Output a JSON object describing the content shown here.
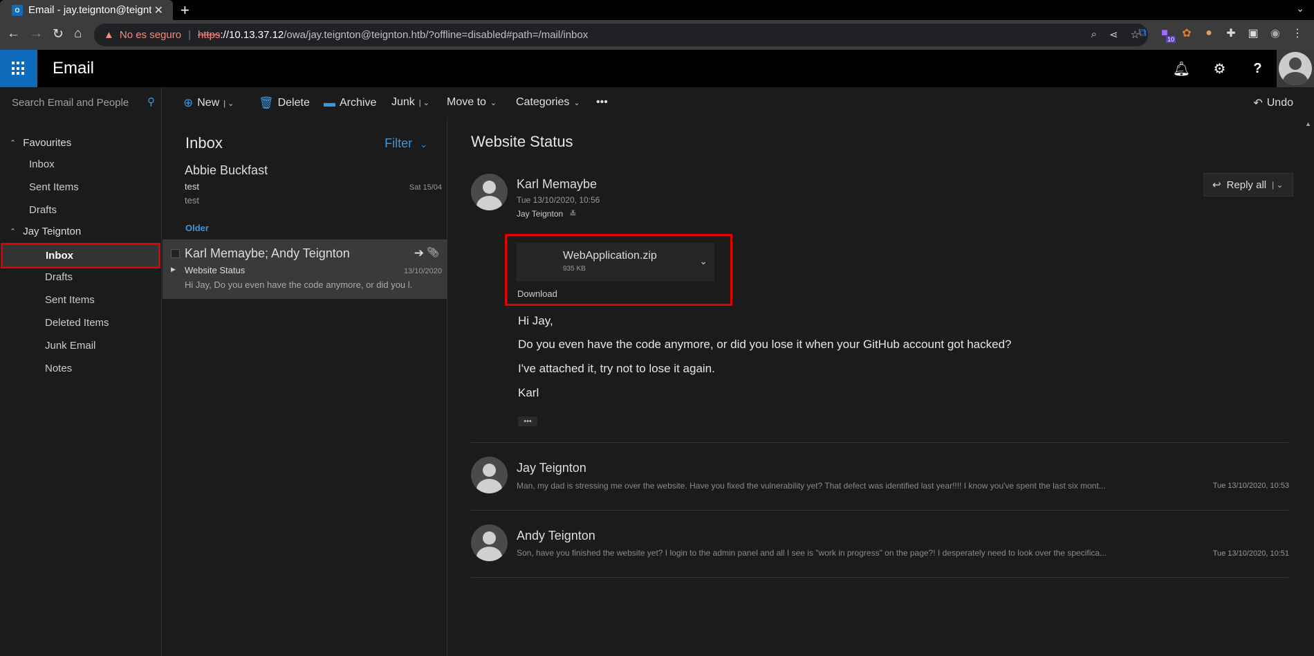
{
  "browser": {
    "tab_title": "Email - jay.teignton@teignton",
    "favicon_label": "O",
    "new_tab": "+",
    "security_label": "No es seguro",
    "url_scheme": "https",
    "url_host": "://10.13.37.12",
    "url_path": "/owa/jay.teignton@teignton.htb/?offline=disabled#path=/mail/inbox",
    "extension_badge": "10"
  },
  "app": {
    "title": "Email"
  },
  "search": {
    "placeholder": "Search Email and People"
  },
  "nav": {
    "favourites_label": "Favourites",
    "favourites": [
      {
        "label": "Inbox"
      },
      {
        "label": "Sent Items"
      },
      {
        "label": "Drafts"
      }
    ],
    "account_label": "Jay Teignton",
    "folders": [
      {
        "label": "Inbox"
      },
      {
        "label": "Drafts"
      },
      {
        "label": "Sent Items"
      },
      {
        "label": "Deleted Items"
      },
      {
        "label": "Junk Email"
      },
      {
        "label": "Notes"
      }
    ]
  },
  "commands": {
    "new": "New",
    "delete": "Delete",
    "archive": "Archive",
    "junk": "Junk",
    "move_to": "Move to",
    "categories": "Categories",
    "more": "•••",
    "undo": "Undo"
  },
  "list": {
    "heading": "Inbox",
    "filter": "Filter",
    "older": "Older",
    "messages": [
      {
        "sender": "Abbie Buckfast",
        "subject": "test",
        "preview": "test",
        "date": "Sat 15/04"
      },
      {
        "sender": "Karl Memaybe; Andy Teignton",
        "subject": "Website Status",
        "preview": "Hi Jay, Do you even have the code anymore, or did you l...",
        "date": "13/10/2020"
      }
    ]
  },
  "reading": {
    "subject": "Website Status",
    "from": "Karl Memaybe",
    "date": "Tue 13/10/2020, 10:56",
    "to": "Jay Teignton",
    "reply_all": "Reply all",
    "attachment": {
      "name": "WebApplication.zip",
      "size": "935 KB",
      "download": "Download"
    },
    "body": [
      "Hi Jay,",
      "Do you even have the code anymore, or did you lose it when your GitHub account got hacked?",
      "I've attached it, try not to lose it again.",
      "Karl"
    ],
    "more": "•••",
    "thread": [
      {
        "from": "Jay Teignton",
        "preview": "Man, my dad is stressing me over the website. Have you fixed the vulnerability yet? That defect was identified last year!!!! I know you've spent the last six mont...",
        "date": "Tue 13/10/2020, 10:53"
      },
      {
        "from": "Andy Teignton",
        "preview": "Son, have you finished the website yet? I login to the admin panel and all I see is \"work in progress\" on the page?! I desperately need to look over the specifica...",
        "date": "Tue 13/10/2020, 10:51"
      }
    ]
  },
  "colors": {
    "accent": "#0f6cbd",
    "link": "#3a96dd",
    "highlight_border": "#e00000",
    "background": "#1b1b1b"
  }
}
